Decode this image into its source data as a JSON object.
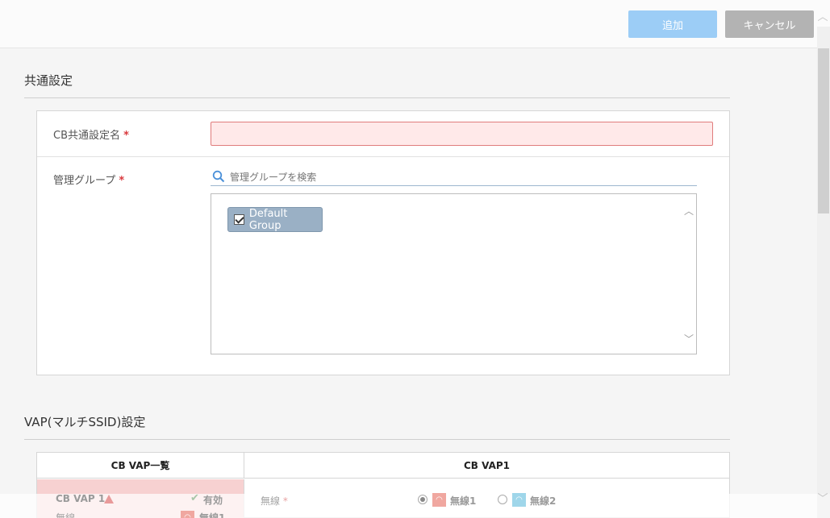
{
  "toolbar": {
    "add_label": "追加",
    "cancel_label": "キャンセル"
  },
  "common": {
    "section_title": "共通設定",
    "name_label": "CB共通設定名",
    "name_required": "*",
    "name_value": "",
    "group_label": "管理グループ",
    "group_required": "*",
    "group_search_placeholder": "管理グループを検索",
    "groups": [
      {
        "name": "Default Group",
        "checked": true
      }
    ]
  },
  "vap": {
    "section_title": "VAP(マルチSSID)設定",
    "list_header": "CB VAP一覧",
    "detail_header": "CB VAP1",
    "items": [
      {
        "name": "CB VAP 1",
        "status": "有効",
        "sub_label": "無線",
        "sub_value": "無線1"
      }
    ],
    "wireless_label": "無線",
    "wireless_required": "*",
    "wireless_options": [
      {
        "label": "無線1",
        "selected": true,
        "color": "#f0a7a0"
      },
      {
        "label": "無線2",
        "selected": false,
        "color": "#9fd6ea"
      }
    ]
  },
  "colors": {
    "accent": "#9ccdf6",
    "error_fill": "#ffe9e9",
    "error_border": "#e07c7c"
  }
}
